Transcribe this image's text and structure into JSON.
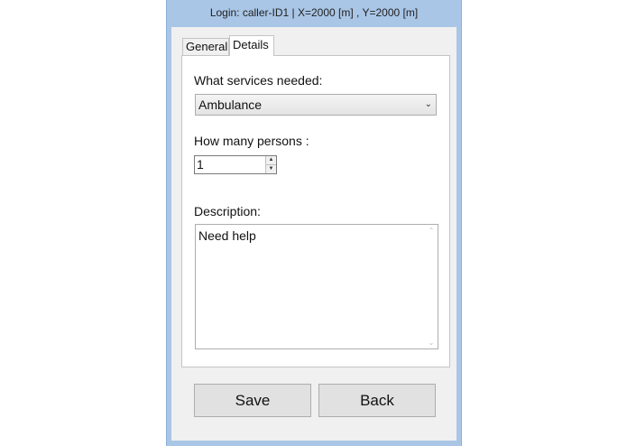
{
  "window": {
    "title": "Login: caller-ID1 | X=2000 [m] , Y=2000 [m]"
  },
  "tabs": [
    {
      "label": "General",
      "selected": false
    },
    {
      "label": "Details",
      "selected": true
    }
  ],
  "details": {
    "services_label": "What services needed:",
    "services_value": "Ambulance",
    "persons_label": "How many persons :",
    "persons_value": "1",
    "description_label": "Description:",
    "description_value": "Need help"
  },
  "buttons": {
    "save_label": "Save",
    "back_label": "Back"
  },
  "icons": {
    "dropdown": "chevron-down-icon",
    "spin_up": "spin-up-icon",
    "spin_down": "spin-down-icon",
    "scroll_up": "scroll-up-icon",
    "scroll_down": "scroll-down-icon"
  }
}
